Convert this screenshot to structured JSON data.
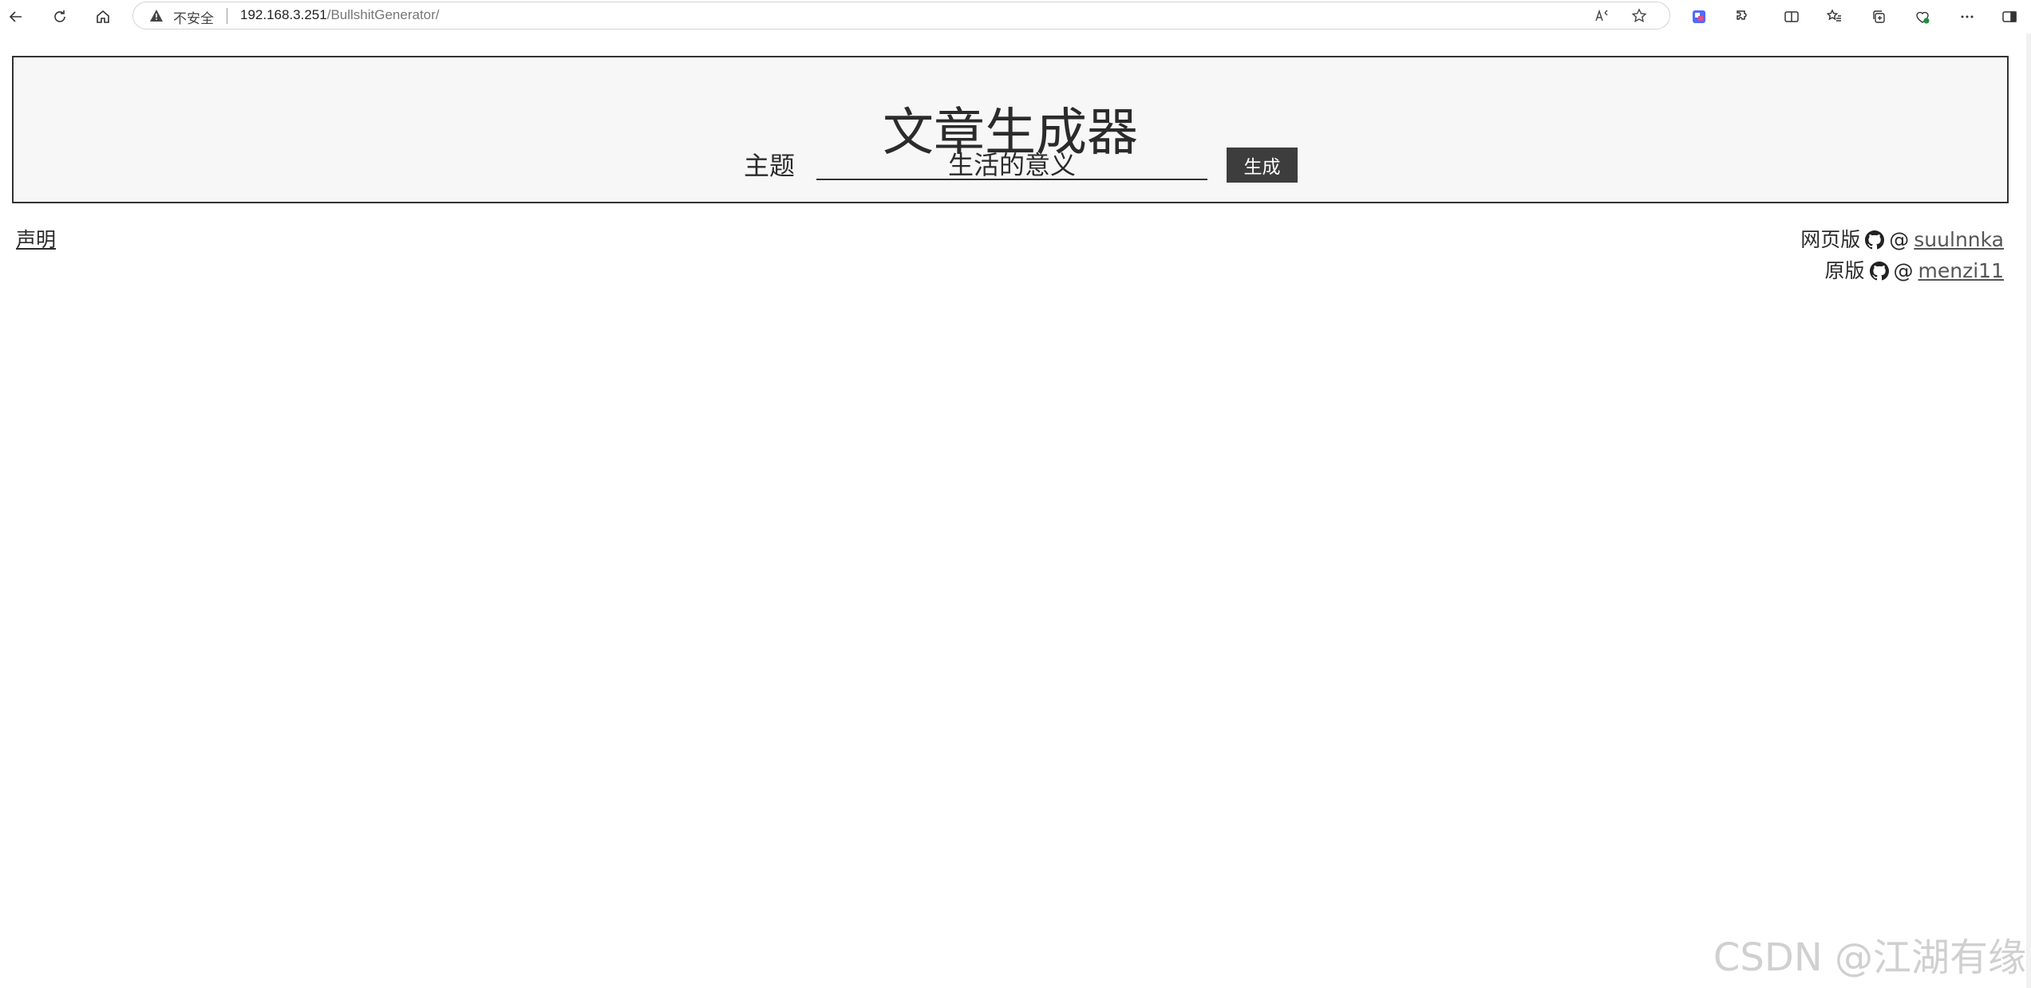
{
  "browser": {
    "security_label": "不安全",
    "url_host": "192.168.3.251",
    "url_path": "/BullshitGenerator/"
  },
  "page": {
    "title": "文章生成器",
    "topic_label": "主题",
    "topic_value": "生活的意义",
    "generate_button": "生成",
    "disclaimer_link": "声明",
    "credits": [
      {
        "prefix": "网页版",
        "at": "@",
        "handle": "suulnnka"
      },
      {
        "prefix": "原版",
        "at": "@",
        "handle": "menzi11"
      }
    ]
  },
  "watermark": "CSDN @江湖有缘",
  "colors": {
    "header_border": "#333333",
    "header_bg": "#f7f7f7",
    "button_bg": "#3d3d3d"
  }
}
